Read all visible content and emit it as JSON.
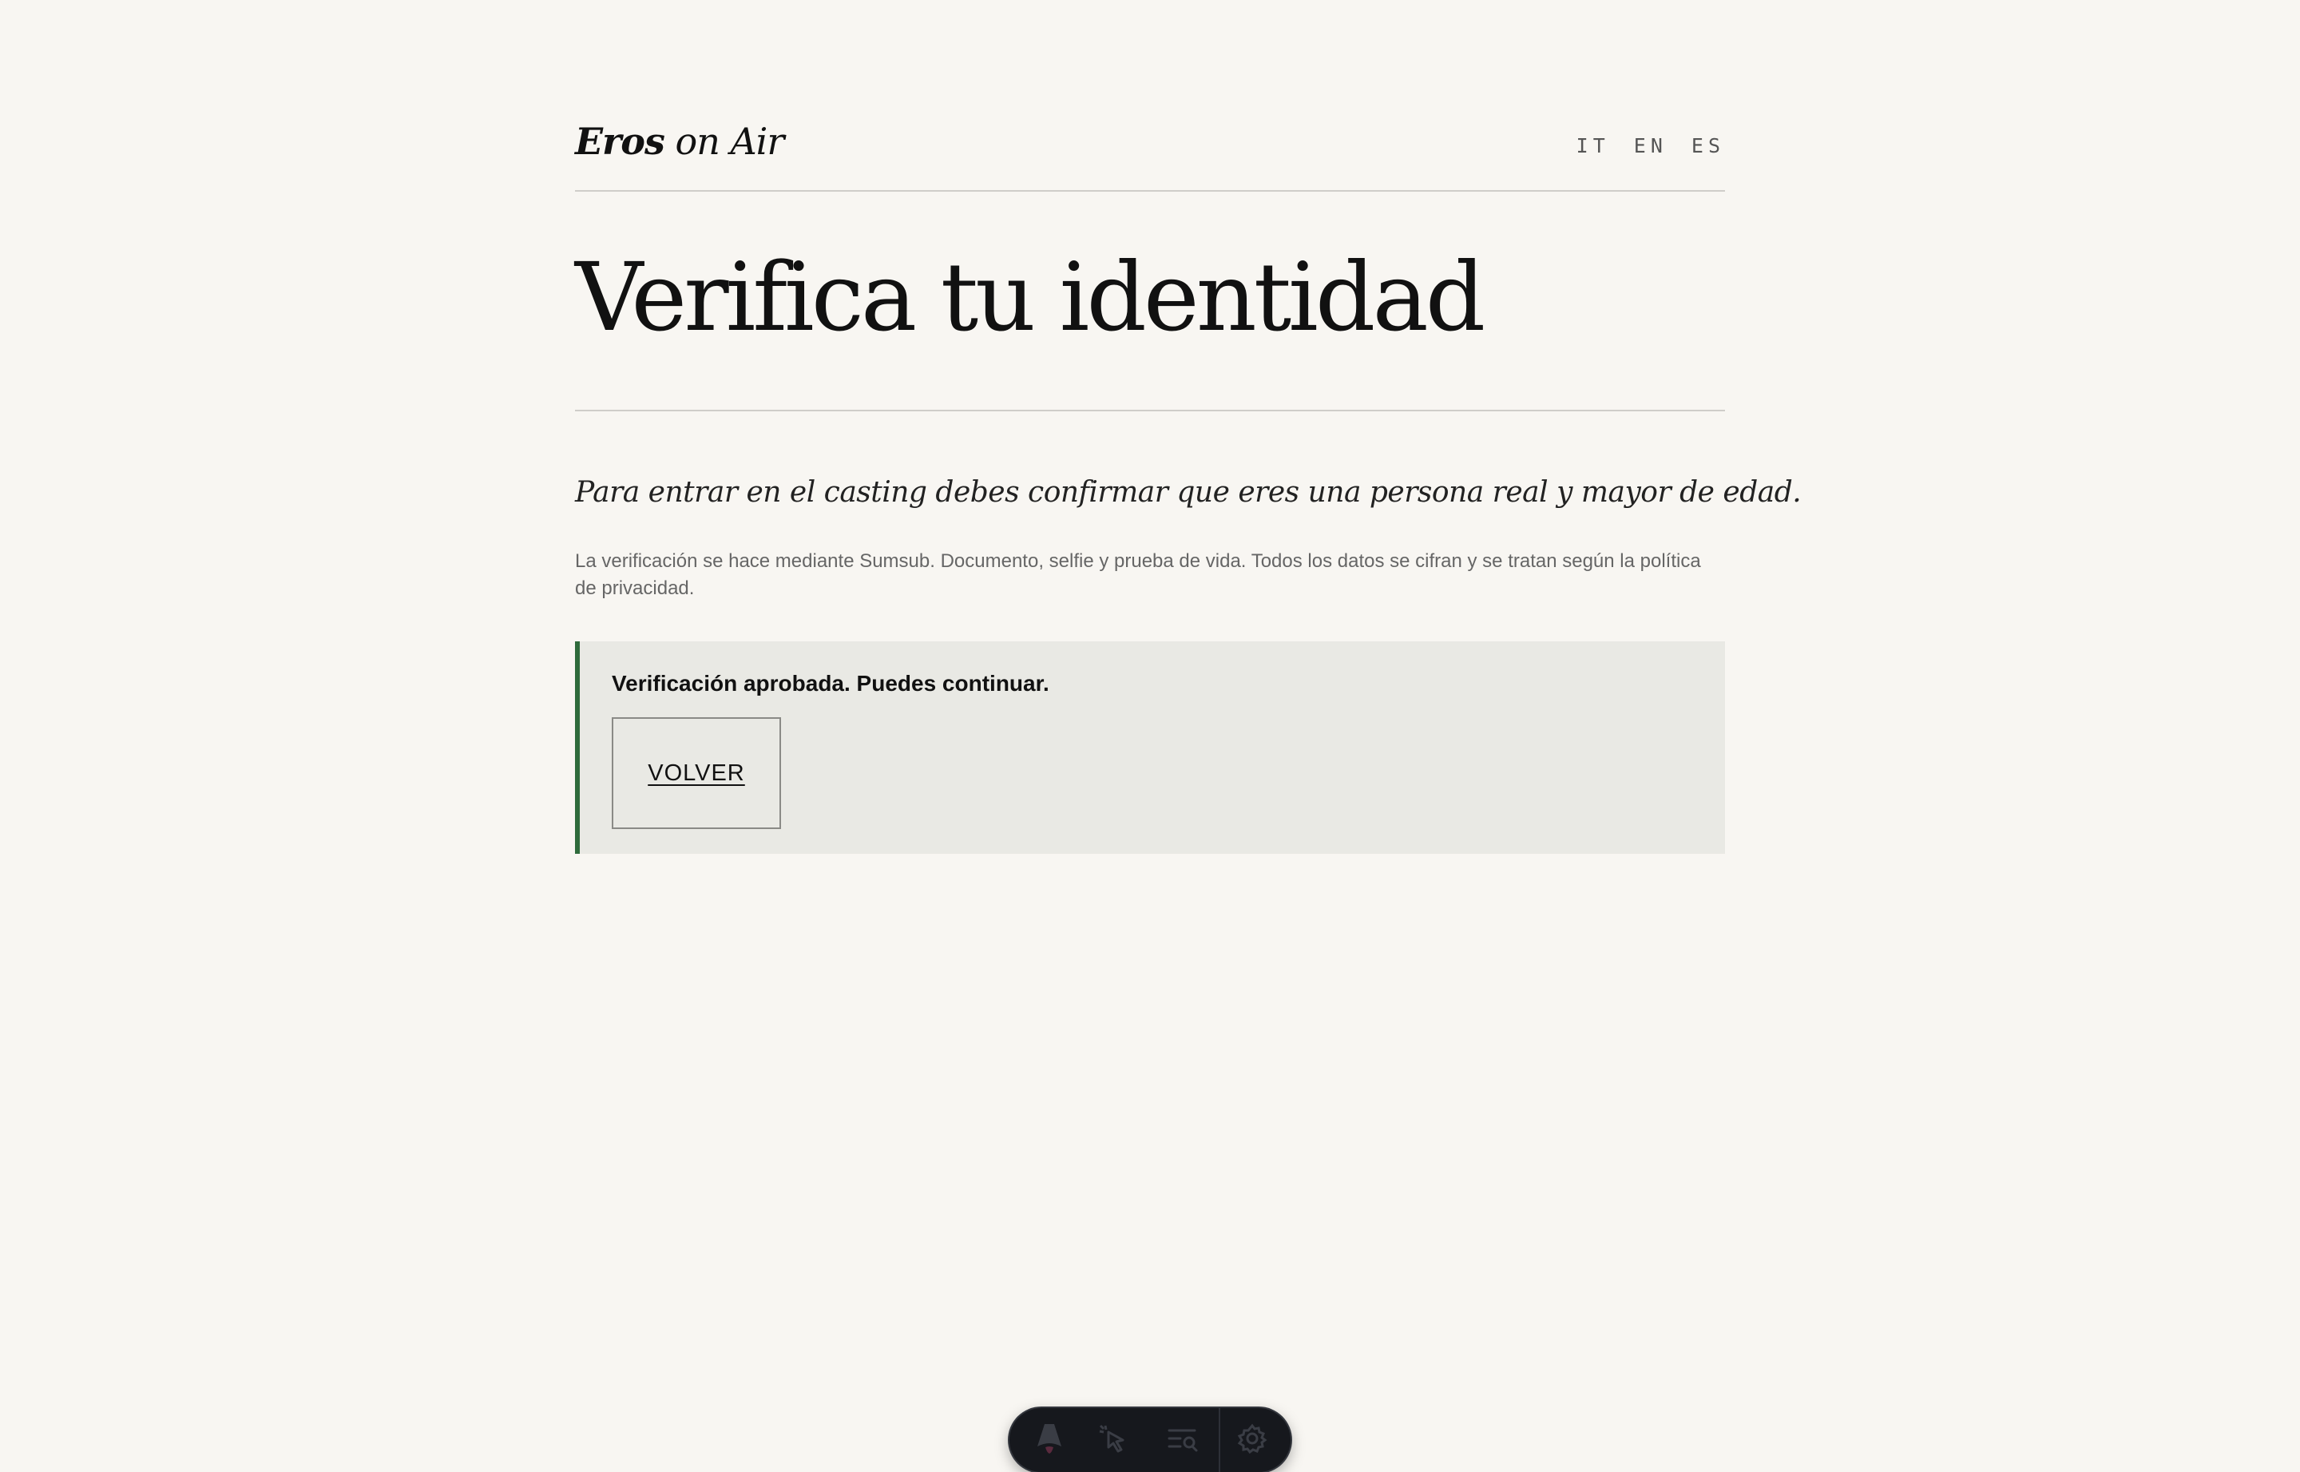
{
  "header": {
    "logo_bold": "Eros",
    "logo_light": "on Air",
    "languages": [
      "IT",
      "EN",
      "ES"
    ]
  },
  "main": {
    "title": "Verifica tu identidad",
    "lead": "Para entrar en el casting debes confirmar que eres una persona real y mayor de edad.",
    "description": "La verificación se hace mediante Sumsub. Documento, selfie y prueba de vida. Todos los datos se cifran y se tratan según la política de privacidad."
  },
  "notice": {
    "message": "Verificación aprobada. Puedes continuar.",
    "button_label": "VOLVER",
    "accent_color": "#2f6b3c"
  },
  "dev_toolbar": {
    "icons": [
      "astro-logo-icon",
      "inspect-cursor-icon",
      "audit-search-icon",
      "settings-gear-icon"
    ]
  },
  "colors": {
    "background": "#f8f6f2",
    "notice_background": "#e9e9e4",
    "text": "#111111"
  }
}
